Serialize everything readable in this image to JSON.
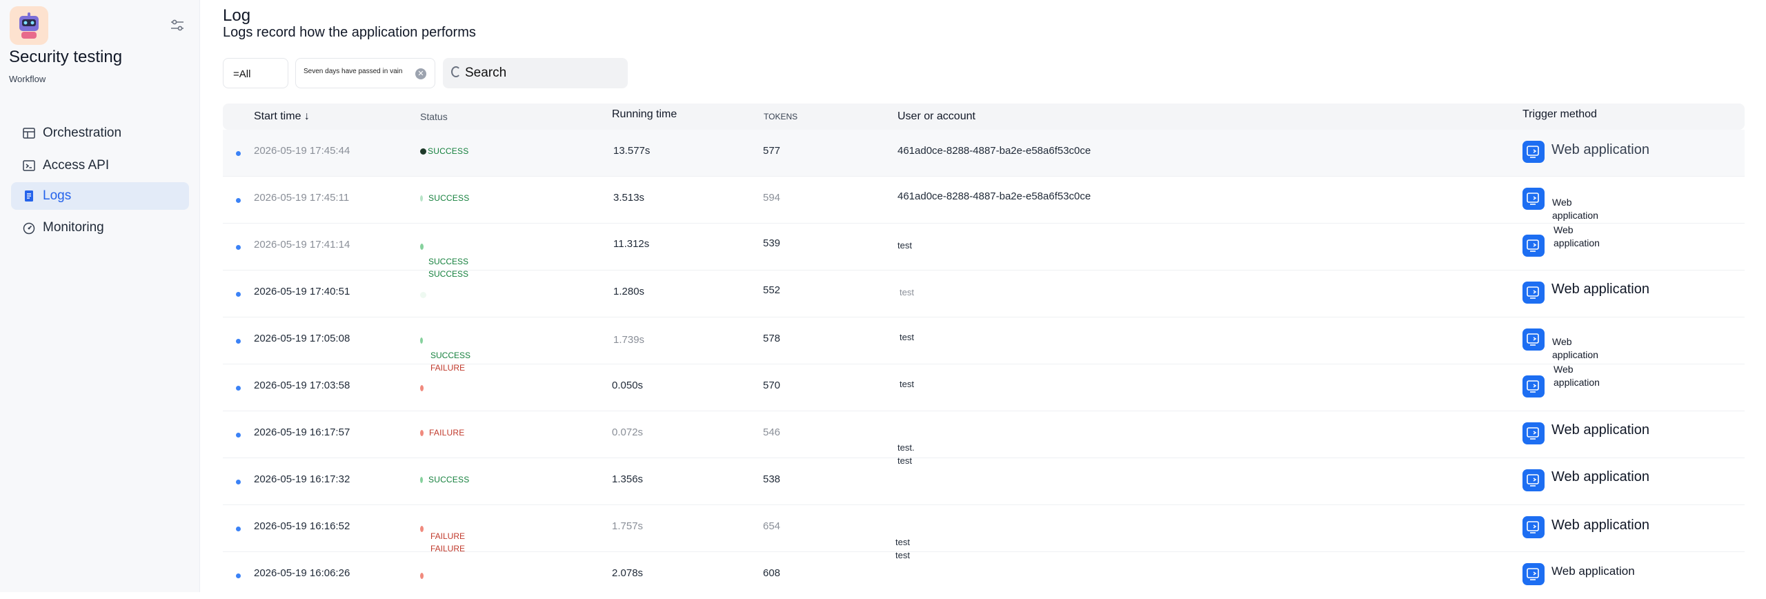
{
  "app": {
    "name": "Security testing",
    "type": "Workflow"
  },
  "nav": {
    "items": [
      {
        "label": "Orchestration",
        "icon": "layout-icon",
        "active": false
      },
      {
        "label": "Access API",
        "icon": "terminal-icon",
        "active": false
      },
      {
        "label": "Logs",
        "icon": "document-icon",
        "active": true
      },
      {
        "label": "Monitoring",
        "icon": "gauge-icon",
        "active": false
      }
    ]
  },
  "page": {
    "title": "Log",
    "description": "Logs record how the application performs"
  },
  "filters": {
    "status_value": "=All",
    "date_value": "Seven days have passed in vain",
    "search_placeholder": "Search"
  },
  "table": {
    "headers": {
      "start_time": "Start time ↓",
      "status": "Status",
      "running_time": "Running time",
      "tokens": "TOKENS",
      "user": "User or account",
      "trigger": "Trigger method"
    },
    "rows": [
      {
        "start_time": "2026-05-19 17:45:44",
        "status": "SUCCESS",
        "running_time": "13.577s",
        "tokens": "577",
        "user": "461ad0ce-8288-4887-ba2e-e58a6f53c0ce",
        "trigger": "Web application"
      },
      {
        "start_time": "2026-05-19 17:45:11",
        "status": "SUCCESS",
        "running_time": "3.513s",
        "tokens": "594",
        "user": "461ad0ce-8288-4887-ba2e-e58a6f53c0ce",
        "trigger": "Web application"
      },
      {
        "start_time": "2026-05-19 17:41:14",
        "status": "",
        "running_time": "11.312s",
        "tokens": "539",
        "user": "test",
        "trigger": "Web application"
      },
      {
        "start_time": "2026-05-19 17:40:51",
        "status": "",
        "running_time": "1.280s",
        "tokens": "552",
        "user": "test",
        "trigger": "Web application"
      },
      {
        "start_time": "2026-05-19 17:05:08",
        "status": "",
        "running_time": "1.739s",
        "tokens": "578",
        "user": "test",
        "trigger": "Web application"
      },
      {
        "start_time": "2026-05-19 17:03:58",
        "status": "",
        "running_time": "0.050s",
        "tokens": "570",
        "user": "test",
        "trigger": "Web application"
      },
      {
        "start_time": "2026-05-19 16:17:57",
        "status": "FAILURE",
        "running_time": "0.072s",
        "tokens": "546",
        "user": "",
        "trigger": "Web application"
      },
      {
        "start_time": "2026-05-19 16:17:32",
        "status": "SUCCESS",
        "running_time": "1.356s",
        "tokens": "538",
        "user": "",
        "trigger": "Web application"
      },
      {
        "start_time": "2026-05-19 16:16:52",
        "status": "",
        "running_time": "1.757s",
        "tokens": "654",
        "user": "",
        "trigger": "Web application"
      },
      {
        "start_time": "2026-05-19 16:06:26",
        "status": "",
        "running_time": "2.078s",
        "tokens": "608",
        "user": "",
        "trigger": "Web application"
      }
    ],
    "stray_texts": {
      "success_a": "SUCCESS",
      "success_b": "SUCCESS",
      "success_c": "SUCCESS",
      "failure_a": "FAILURE",
      "failure_b": "FAILURE",
      "failure_c": "FAILURE",
      "test_dot": "test.",
      "test_a": "test",
      "test_b": "test",
      "test_c": "test"
    }
  },
  "colors": {
    "accent": "#2563eb",
    "success": "#15803d",
    "failure": "#c0392b",
    "trigger_icon_bg": "#1d6ef2"
  }
}
